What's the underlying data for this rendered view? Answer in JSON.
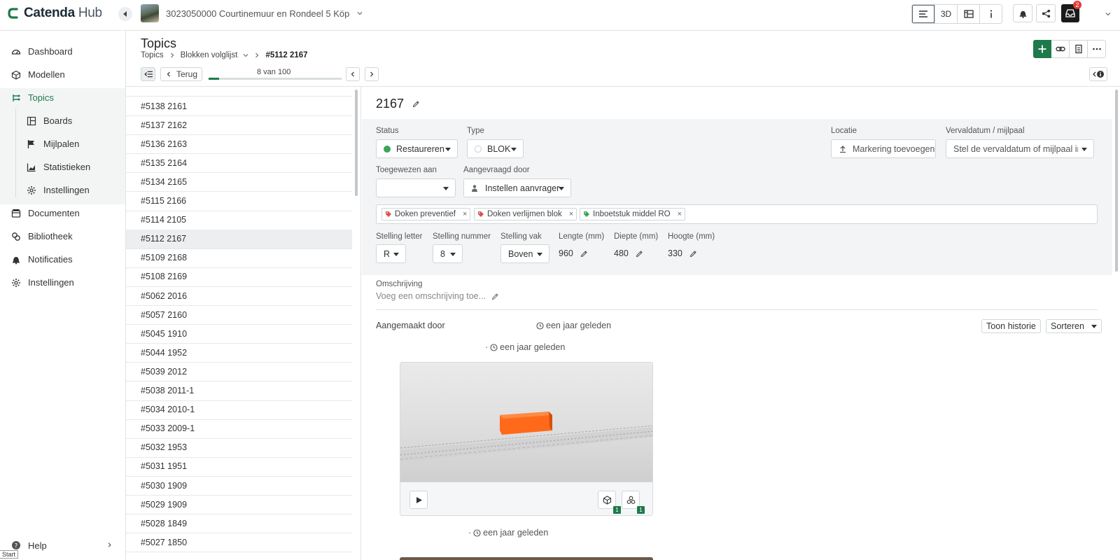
{
  "app": {
    "logo_text": "Catenda",
    "logo_suffix": "Hub"
  },
  "project": {
    "name": "3023050000 Courtinemuur en Rondeel 5 Köp"
  },
  "topbar": {
    "view_3d_label": "3D",
    "notification_count": "2",
    "colors": {
      "brand_green": "#1e7a4a",
      "badge_red": "#e53935"
    }
  },
  "sidebar": {
    "items": [
      {
        "label": "Dashboard",
        "icon": "dashboard-icon"
      },
      {
        "label": "Modellen",
        "icon": "cube-icon"
      },
      {
        "label": "Topics",
        "icon": "topics-icon",
        "active": true
      },
      {
        "label": "Boards",
        "icon": "board-icon",
        "sub": true
      },
      {
        "label": "Mijlpalen",
        "icon": "flag-icon",
        "sub": true
      },
      {
        "label": "Statistieken",
        "icon": "chart-icon",
        "sub": true
      },
      {
        "label": "Instellingen",
        "icon": "gear-icon",
        "sub": true
      },
      {
        "label": "Documenten",
        "icon": "documents-icon"
      },
      {
        "label": "Bibliotheek",
        "icon": "library-icon"
      },
      {
        "label": "Notificaties",
        "icon": "bell-icon"
      },
      {
        "label": "Instellingen",
        "icon": "gear-icon"
      }
    ],
    "help_label": "Help",
    "start_label": "Start"
  },
  "header": {
    "title": "Topics",
    "breadcrumb": [
      "Topics",
      "Blokken volglijst",
      "#5112 2167"
    ],
    "back_label": "Terug",
    "position_label": "8 van 100",
    "progress": 0.08
  },
  "list": {
    "rows": [
      "#5138 2161",
      "#5137 2162",
      "#5136 2163",
      "#5135 2164",
      "#5134 2165",
      "#5115 2166",
      "#5114 2105",
      "#5112 2167",
      "#5109 2168",
      "#5108 2169",
      "#5062 2016",
      "#5057 2160",
      "#5045 1910",
      "#5044 1952",
      "#5039 2012",
      "#5038 2011-1",
      "#5034 2010-1",
      "#5033 2009-1",
      "#5032 1953",
      "#5031 1951",
      "#5030 1909",
      "#5029 1909",
      "#5028 1849",
      "#5027 1850"
    ],
    "selected_index": 7
  },
  "detail": {
    "title": "2167",
    "status": {
      "label": "Status",
      "value": "Restaureren",
      "color": "#3aa55a"
    },
    "type": {
      "label": "Type",
      "value": "BLOK"
    },
    "location": {
      "label": "Locatie",
      "value": "Markering toevoegen"
    },
    "due": {
      "label": "Vervaldatum / mijlpaal",
      "value": "Stel de vervaldatum of mijlpaal in"
    },
    "assigned": {
      "label": "Toegewezen aan",
      "value": ""
    },
    "requested": {
      "label": "Aangevraagd door",
      "value": "Instellen aanvrager"
    },
    "tags": [
      "Doken preventief",
      "Doken verlijmen blok",
      "Inboetstuk middel RO"
    ],
    "stelling_letter": {
      "label": "Stelling letter",
      "value": "R"
    },
    "stelling_nummer": {
      "label": "Stelling nummer",
      "value": "8"
    },
    "stelling_vak": {
      "label": "Stelling vak",
      "value": "Boven"
    },
    "lengte": {
      "label": "Lengte (mm)",
      "value": "960"
    },
    "diepte": {
      "label": "Diepte (mm)",
      "value": "480"
    },
    "hoogte": {
      "label": "Hoogte (mm)",
      "value": "330"
    },
    "description": {
      "label": "Omschrijving",
      "placeholder": "Voeg een omschrijving toe..."
    },
    "created_by_label": "Aangemaakt door",
    "created_time": "een jaar geleden",
    "history_label": "Toon historie",
    "sort_label": "Sorteren",
    "comment_time": "een jaar geleden",
    "viewpoint_counts": [
      "1",
      "1"
    ],
    "next_comment_time": "een jaar geleden"
  }
}
